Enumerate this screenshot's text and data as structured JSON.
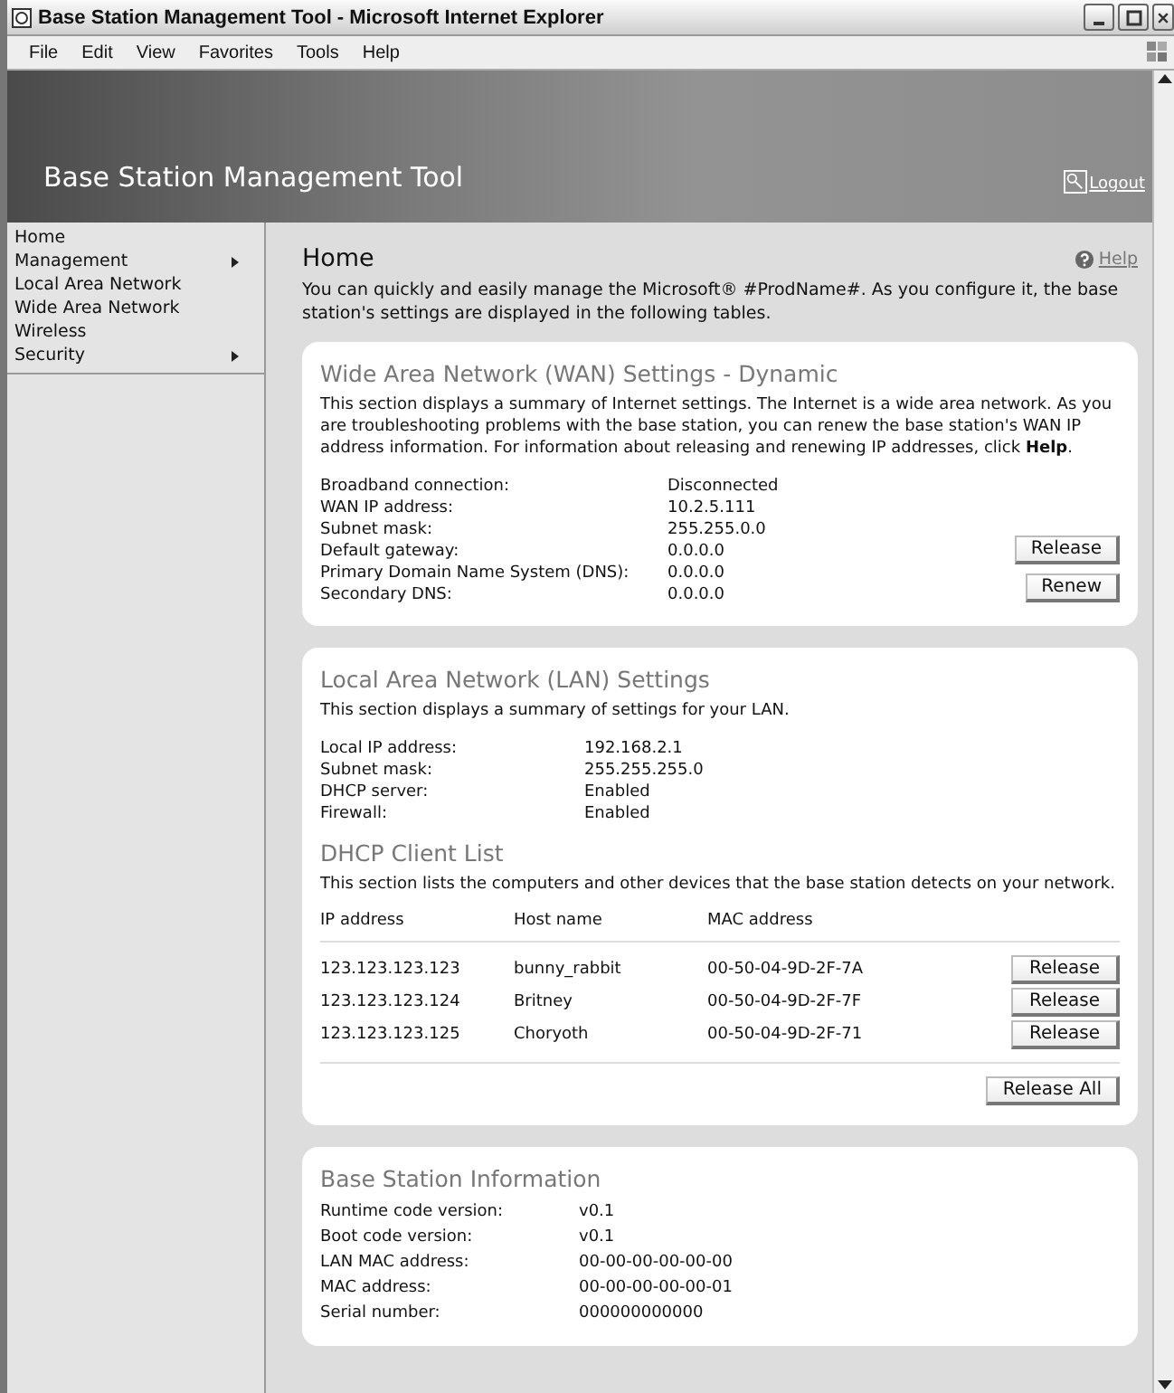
{
  "window": {
    "title": "Base Station Management Tool - Microsoft Internet Explorer"
  },
  "menu": [
    "File",
    "Edit",
    "View",
    "Favorites",
    "Tools",
    "Help"
  ],
  "header": {
    "title": "Base Station Management Tool",
    "logout": "Logout"
  },
  "sidebar": {
    "items": [
      {
        "label": "Home",
        "has_submenu": false
      },
      {
        "label": "Management",
        "has_submenu": true
      },
      {
        "label": "Local Area Network",
        "has_submenu": false
      },
      {
        "label": "Wide Area Network",
        "has_submenu": false
      },
      {
        "label": "Wireless",
        "has_submenu": false
      },
      {
        "label": "Security",
        "has_submenu": true
      }
    ]
  },
  "page": {
    "title": "Home",
    "help": "Help",
    "intro": "You can quickly and easily manage the Microsoft® #ProdName#. As you configure it, the base station's settings are displayed in the following tables."
  },
  "wan": {
    "title": "Wide Area Network (WAN) Settings - Dynamic",
    "description": "This section displays a summary of Internet settings. The Internet is a wide area network. As you are troubleshooting problems with the base station, you can renew the base station's WAN IP address information. For information about releasing and renewing IP addresses, click **Help**.",
    "fields": [
      {
        "label": "Broadband connection:",
        "value": "Disconnected"
      },
      {
        "label": "WAN IP address:",
        "value": "10.2.5.111"
      },
      {
        "label": "Subnet mask:",
        "value": "255.255.0.0"
      },
      {
        "label": "Default gateway:",
        "value": "0.0.0.0"
      },
      {
        "label": "Primary Domain Name System (DNS):",
        "value": "0.0.0.0"
      },
      {
        "label": "Secondary DNS:",
        "value": "0.0.0.0"
      }
    ],
    "buttons": [
      "Release",
      "Renew"
    ]
  },
  "lan": {
    "title": "Local Area Network (LAN) Settings",
    "description": "This section displays a summary of settings for your LAN.",
    "fields": [
      {
        "label": "Local IP address:",
        "value": "192.168.2.1"
      },
      {
        "label": "Subnet mask:",
        "value": "255.255.255.0"
      },
      {
        "label": "DHCP server:",
        "value": "Enabled"
      },
      {
        "label": "Firewall:",
        "value": "Enabled"
      }
    ]
  },
  "dhcp": {
    "title": "DHCP Client List",
    "description": "This section lists the computers and other devices that the base station detects on your network.",
    "columns": [
      "IP address",
      "Host name",
      "MAC address"
    ],
    "rows": [
      {
        "ip": "123.123.123.123",
        "host": "bunny_rabbit",
        "mac": "00-50-04-9D-2F-7A",
        "button": "Release"
      },
      {
        "ip": "123.123.123.124",
        "host": "Britney",
        "mac": "00-50-04-9D-2F-7F",
        "button": "Release"
      },
      {
        "ip": "123.123.123.125",
        "host": "Choryoth",
        "mac": "00-50-04-9D-2F-71",
        "button": "Release"
      }
    ],
    "release_all": "Release All"
  },
  "info": {
    "title": "Base Station Information",
    "fields": [
      {
        "label": "Runtime code version:",
        "value": "v0.1"
      },
      {
        "label": "Boot code version:",
        "value": "v0.1"
      },
      {
        "label": "LAN MAC address:",
        "value": "00-00-00-00-00-00"
      },
      {
        "label": "MAC address:",
        "value": "00-00-00-00-00-01"
      },
      {
        "label": "Serial number:",
        "value": "000000000000"
      }
    ]
  }
}
